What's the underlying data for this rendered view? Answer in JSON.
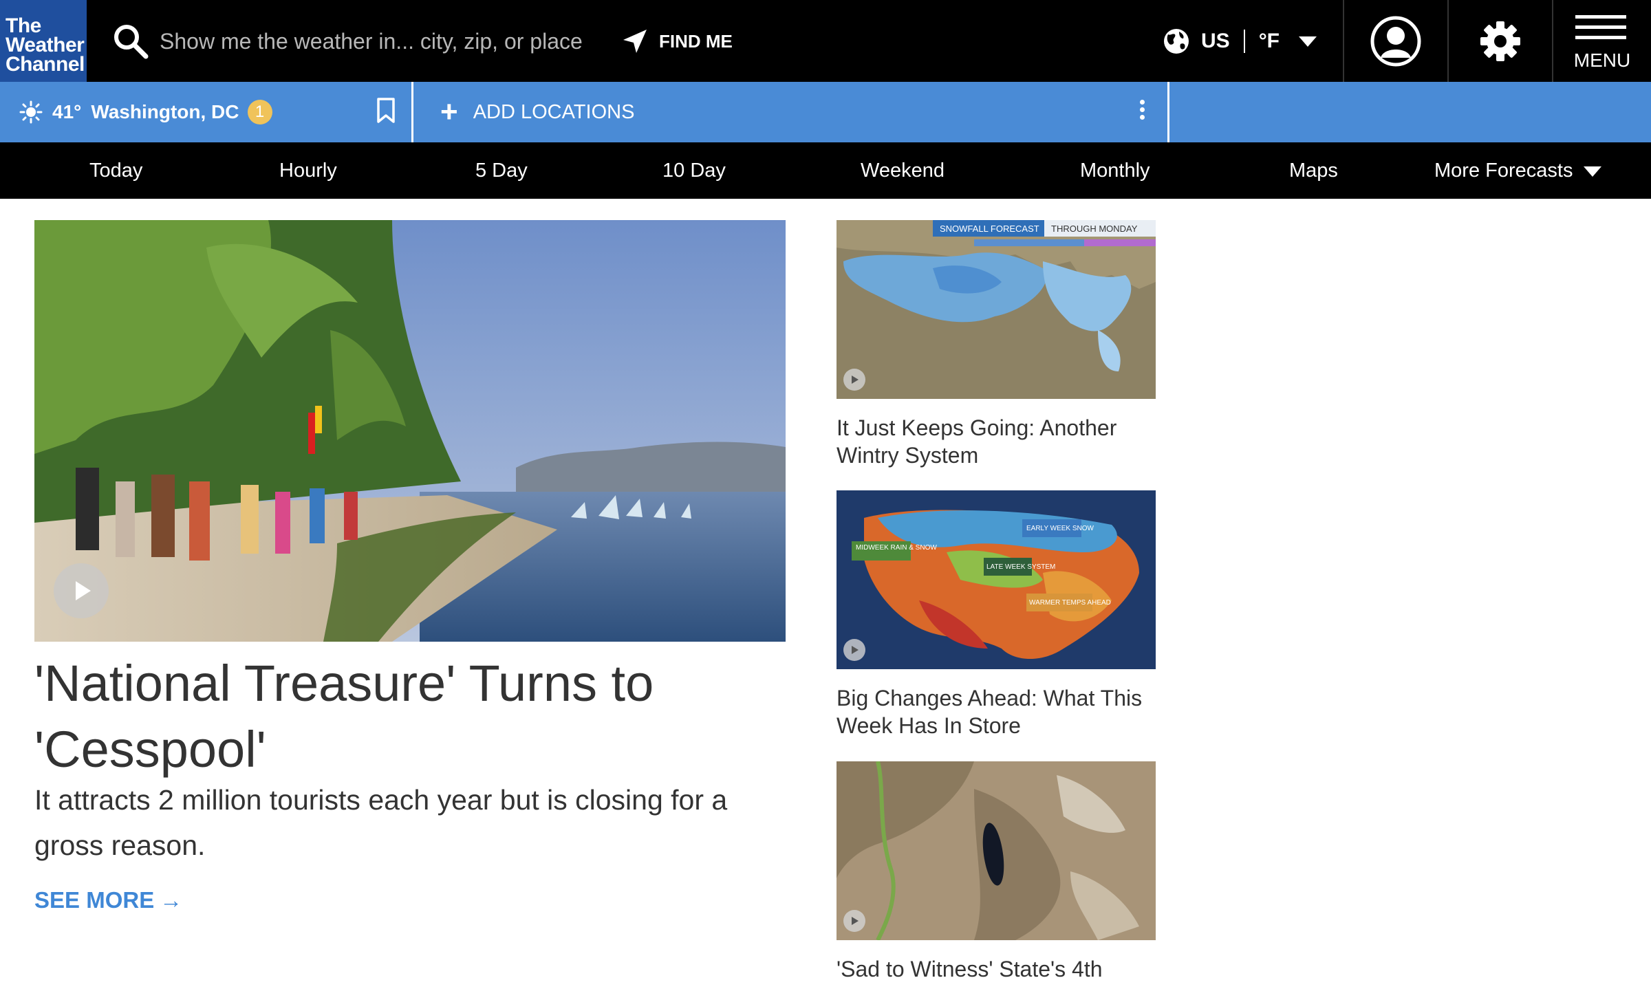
{
  "header": {
    "logo_lines": [
      "The",
      "Weather",
      "Channel"
    ],
    "search_placeholder": "Show me the weather in... city, zip, or place",
    "find_me": "FIND ME",
    "country": "US",
    "unit": "°F",
    "menu_label": "MENU"
  },
  "location_bar": {
    "temperature": "41°",
    "city": "Washington, DC",
    "alert_count": "1",
    "add_locations": "ADD LOCATIONS"
  },
  "nav": {
    "items": [
      "Today",
      "Hourly",
      "5 Day",
      "10 Day",
      "Weekend",
      "Monthly",
      "Maps",
      "More Forecasts"
    ]
  },
  "hero": {
    "title": "'National Treasure' Turns to 'Cesspool'",
    "subtitle": "It attracts 2 million tourists each year but is closing for a gross reason.",
    "see_more": "SEE MORE"
  },
  "side_videos": [
    {
      "title": "It Just Keeps Going: Another Wintry System",
      "map_tag_1": "SNOWFALL FORECAST",
      "map_tag_2": "THROUGH MONDAY"
    },
    {
      "title": "Big Changes Ahead: What This Week Has In Store",
      "label_1": "MIDWEEK RAIN & SNOW",
      "label_2": "EARLY WEEK SNOW",
      "label_3": "LATE WEEK SYSTEM",
      "label_4": "WARMER TEMPS AHEAD"
    },
    {
      "title": "'Sad to Witness' State's 4th"
    }
  ],
  "colors": {
    "brand_blue": "#1f4f9e",
    "location_bar": "#4a8bd6",
    "link_blue": "#3f87d6",
    "alert_badge": "#f0c35a"
  },
  "icons": [
    "search-icon",
    "location-arrow-icon",
    "globe-icon",
    "user-icon",
    "gear-icon",
    "menu-icon",
    "sun-icon",
    "bookmark-icon",
    "plus-icon",
    "kebab-icon",
    "play-icon"
  ]
}
